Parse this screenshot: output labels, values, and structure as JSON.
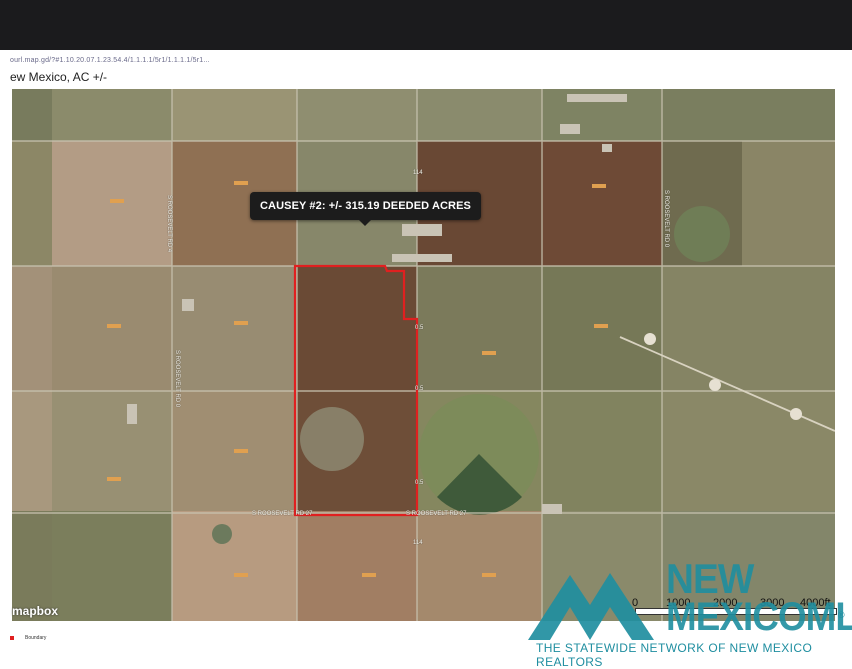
{
  "header": {
    "url_fragment": "ourl.map.gd/?#1.10.20.07.1.23.54.4/1.1.1.1/5r1/1.1.1.1/5r1...",
    "title": "ew Mexico,  AC +/-"
  },
  "map": {
    "callout": "CAUSEY #2: +/- 315.19 DEEDED ACRES",
    "road_labels": [
      "S ROOSEVELT RD 27",
      "S ROOSEVELT RD 27",
      "S ROOSEVELT RD 4",
      "S ROOSEVELT RD 0",
      "S ROOSEVELT RD 0"
    ],
    "route_markers": [
      "114",
      "114",
      "0.5",
      "0.5",
      "0.5"
    ],
    "attribution": "mapbox",
    "boundary_color": "#e02020",
    "scale": {
      "labels": [
        "0",
        "1000",
        "2000",
        "3000",
        "4000ft"
      ]
    }
  },
  "legend": {
    "label": "Boundary"
  },
  "logo": {
    "line1": "NEW",
    "line2": "MEXICOMLS",
    "registered": "®",
    "tagline": "THE STATEWIDE NETWORK OF NEW MEXICO REALTORS",
    "brand_color": "#1f8ea0"
  },
  "icons": [
    "mapbox-logo-icon",
    "new-mexico-mls-mountain-logo"
  ]
}
